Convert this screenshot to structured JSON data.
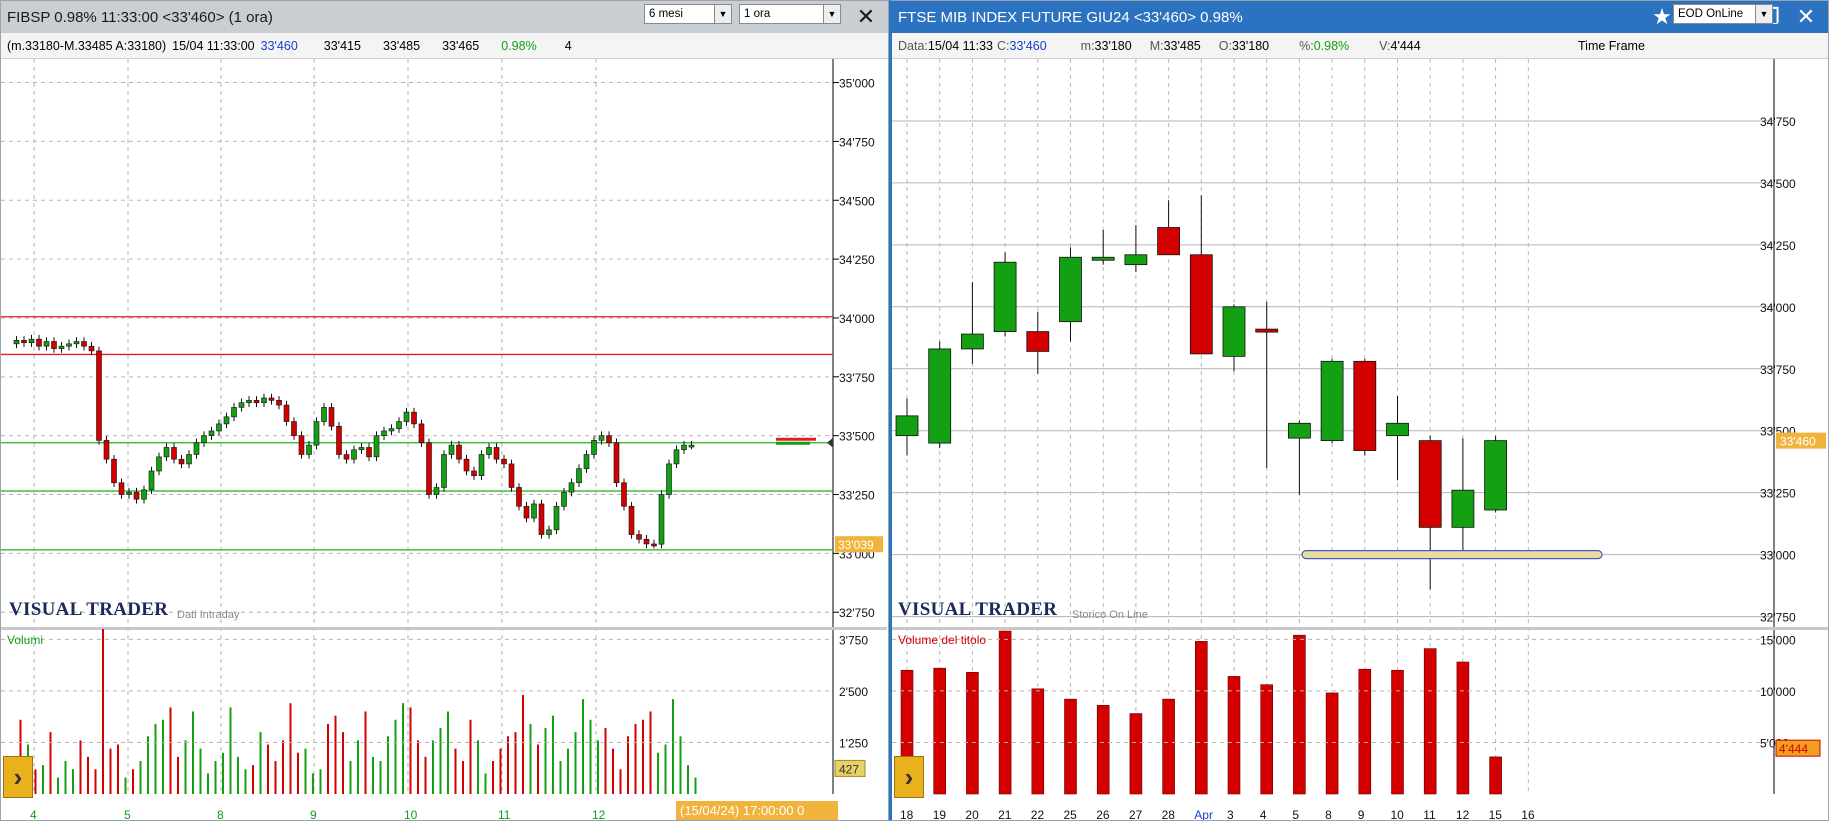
{
  "colors": {
    "up": "#13a013",
    "down": "#d40000",
    "grid": "#b6b6b6",
    "hline_red": "#e02020",
    "hline_green": "#22b022",
    "badge": "#f0b43c"
  },
  "left": {
    "title": "FIBSP 0.98% 11:33:00  <33'460> (1 ora)",
    "info": {
      "range": "(m.33180-M.33485 A:33180)",
      "datetime": "15/04 11:33:00",
      "last": "33'460",
      "v1": "33'415",
      "v2": "33'485",
      "v3": "33'465",
      "pct": "0.98%",
      "trunc": "4"
    },
    "period_select": "6 mesi",
    "interval_select": "1 ora",
    "watermark": "VISUAL TRADER",
    "watermark_sub": "Dati Intraday",
    "price_badge": "33'039",
    "volume_label": "Volumi",
    "volume_badge": "427",
    "footer_date": "(15/04/24) 17:00:00 0",
    "icons": [
      "star-icon",
      "tools-icon",
      "minimize-icon",
      "maximize-icon",
      "close-icon"
    ]
  },
  "right": {
    "title": "FTSE MIB INDEX FUTURE GIU24 <33'460> 0.98%",
    "info": {
      "data_label": "Data:",
      "data_val": "15/04 11:33",
      "c_label": "C:",
      "c_val": "33'460",
      "m_label": "m:",
      "m_val": "33'180",
      "M_label": "M:",
      "M_val": "33'485",
      "o_label": "O:",
      "o_val": "33'180",
      "pct_label": "%:",
      "pct_val": "0.98%",
      "v_label": "V:",
      "v_val": "4'444"
    },
    "timeframe_label": "Time Frame",
    "timeframe_select": "EOD OnLine",
    "watermark": "VISUAL TRADER",
    "watermark_sub": "Storico On Line",
    "price_badge": "33'460",
    "volume_label": "Volume del titolo",
    "volume_badge": "4'444",
    "icons": [
      "star-icon",
      "tools-icon",
      "minimize-icon",
      "maximize-icon",
      "close-icon"
    ]
  },
  "chart_data": [
    {
      "type": "candlestick",
      "title": "FIBSP 1 ora",
      "y_ticks": [
        "35'000",
        "34'750",
        "34'500",
        "34'250",
        "34'000",
        "33'750",
        "33'500",
        "33'250",
        "33'000",
        "32'750"
      ],
      "ylim": [
        32700,
        35100
      ],
      "x_ticks": [
        "4",
        "5",
        "8",
        "9",
        "10",
        "11",
        "12"
      ],
      "hlines": [
        {
          "value": 34005,
          "color": "red"
        },
        {
          "value": 33845,
          "color": "red"
        },
        {
          "value": 33470,
          "color": "green"
        },
        {
          "value": 33265,
          "color": "green"
        },
        {
          "value": 33015,
          "color": "green"
        }
      ],
      "close_path": [
        33890,
        33905,
        33895,
        33910,
        33880,
        33900,
        33870,
        33880,
        33890,
        33900,
        33880,
        33860,
        33480,
        33400,
        33300,
        33250,
        33260,
        33230,
        33270,
        33350,
        33410,
        33450,
        33400,
        33380,
        33420,
        33470,
        33500,
        33520,
        33550,
        33580,
        33620,
        33640,
        33650,
        33640,
        33660,
        33650,
        33630,
        33560,
        33500,
        33420,
        33460,
        33560,
        33620,
        33540,
        33420,
        33400,
        33440,
        33450,
        33410,
        33500,
        33520,
        33530,
        33560,
        33600,
        33550,
        33470,
        33250,
        33280,
        33420,
        33460,
        33400,
        33350,
        33330,
        33420,
        33450,
        33400,
        33380,
        33280,
        33200,
        33150,
        33210,
        33080,
        33100,
        33200,
        33260,
        33300,
        33360,
        33420,
        33480,
        33500,
        33470,
        33300,
        33200,
        33080,
        33060,
        33040,
        33039,
        33250,
        33380,
        33440,
        33460,
        33460
      ],
      "volume": {
        "y_ticks": [
          "3'750",
          "2'500",
          "1'250"
        ],
        "ylim": [
          0,
          4000
        ],
        "values": [
          900,
          1800,
          1200,
          600,
          700,
          1500,
          400,
          800,
          600,
          1300,
          900,
          600,
          4000,
          1100,
          1200,
          400,
          600,
          800,
          1400,
          1700,
          1800,
          2100,
          900,
          1300,
          2000,
          1100,
          500,
          800,
          1000,
          2100,
          900,
          600,
          700,
          1500,
          1200,
          800,
          1300,
          2200,
          1000,
          1100,
          500,
          600,
          1700,
          1900,
          1500,
          800,
          1300,
          2000,
          900,
          800,
          1400,
          1800,
          2200,
          2100,
          1300,
          900,
          1300,
          1600,
          2000,
          1100,
          800,
          1800,
          1300,
          500,
          800,
          1100,
          1400,
          1500,
          2400,
          1700,
          1200,
          1600,
          1900,
          800,
          1100,
          1500,
          2300,
          1800,
          1300,
          1600,
          1100,
          600,
          1400,
          1700,
          1800,
          2000,
          1000,
          1200,
          2300,
          1400,
          700,
          400
        ]
      }
    },
    {
      "type": "candlestick",
      "title": "FTSE MIB INDEX FUTURE GIU24",
      "y_ticks": [
        "34'750",
        "34'500",
        "34'250",
        "34'000",
        "33'750",
        "33'500",
        "33'250",
        "33'000",
        "32'750"
      ],
      "ylim": [
        32720,
        35000
      ],
      "x": [
        "18",
        "19",
        "20",
        "21",
        "22",
        "25",
        "26",
        "27",
        "28",
        "Apr",
        "3",
        "4",
        "5",
        "8",
        "9",
        "10",
        "11",
        "12",
        "15",
        "16"
      ],
      "open": [
        33480,
        33450,
        33830,
        33900,
        33900,
        33940,
        34200,
        34170,
        34320,
        34210,
        33800,
        33910,
        33470,
        33460,
        33780,
        33480,
        33460,
        33110,
        33180,
        null
      ],
      "high": [
        33630,
        33860,
        34100,
        34220,
        33980,
        34240,
        34310,
        34330,
        34430,
        34450,
        34010,
        34020,
        33540,
        33790,
        33790,
        33640,
        33480,
        33470,
        33480,
        null
      ],
      "low": [
        33400,
        33430,
        33770,
        33880,
        33730,
        33860,
        34170,
        34140,
        34260,
        33820,
        33740,
        33350,
        33240,
        33450,
        33400,
        33300,
        32860,
        32990,
        33170,
        null
      ],
      "close": [
        33560,
        33830,
        33890,
        34180,
        33820,
        34200,
        34200,
        34210,
        34210,
        33810,
        34000,
        33900,
        33530,
        33780,
        33420,
        33530,
        33110,
        33260,
        33460,
        null
      ],
      "volume": {
        "y_ticks": [
          "15'000",
          "10'000",
          "5'000"
        ],
        "ylim": [
          0,
          16000
        ],
        "values": [
          12000,
          12200,
          11800,
          15800,
          10200,
          9200,
          8600,
          7800,
          9200,
          14800,
          11400,
          10600,
          15400,
          9800,
          12100,
          12000,
          14100,
          12800,
          3600,
          null
        ]
      }
    }
  ]
}
